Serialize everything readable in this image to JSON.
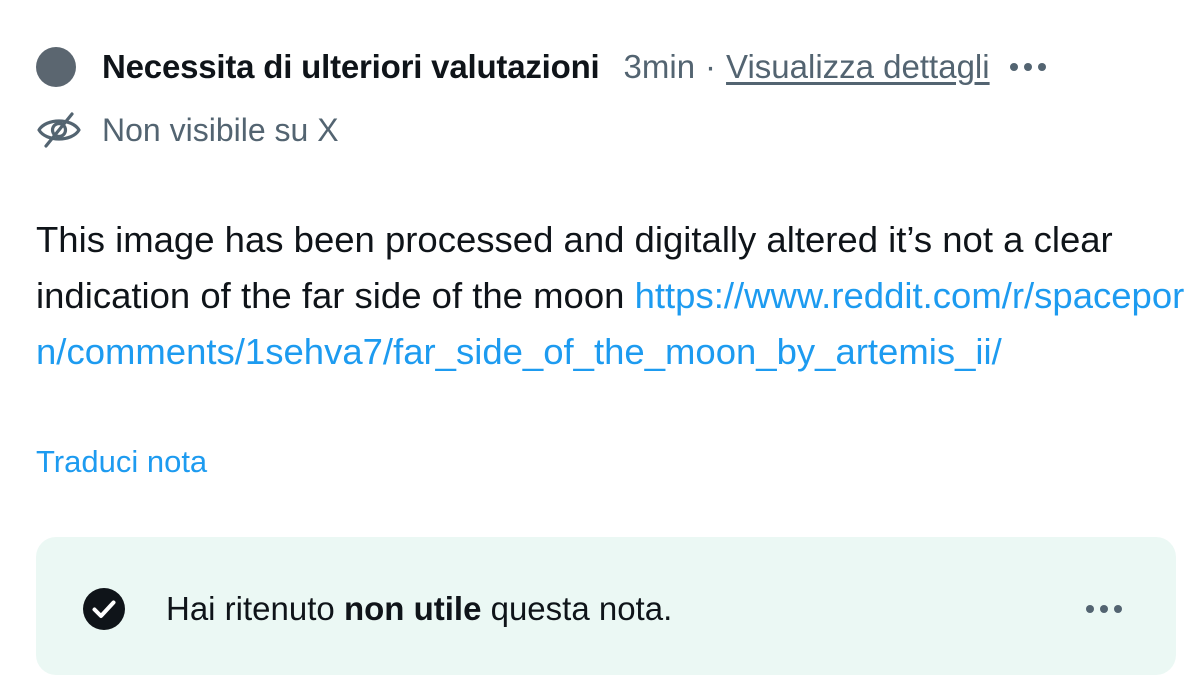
{
  "header": {
    "status": "Necessita di ulteriori valutazioni",
    "time": "3min",
    "separator": "·",
    "details_label": "Visualizza dettagli",
    "more_icon": "more-horizontal-icon"
  },
  "visibility": {
    "icon": "eye-off-icon",
    "label": "Non visibile su X"
  },
  "note": {
    "text": "This image has been processed and digitally altered it’s not a clear indication of the far side of the moon",
    "link": "https://www.reddit.com/r/spaceporn/comments/1sehva7/far_side_of_the_moon_by_artemis_ii/",
    "translate_label": "Traduci nota"
  },
  "rating": {
    "icon": "check-circle-icon",
    "prefix": "Hai ritenuto ",
    "emphasis": "non utile",
    "suffix": " questa nota.",
    "more_icon": "more-horizontal-icon"
  },
  "colors": {
    "status_dot": "#5b6670",
    "secondary_text": "#536471",
    "link": "#1d9bf0",
    "banner_bg": "#ebf8f4"
  }
}
